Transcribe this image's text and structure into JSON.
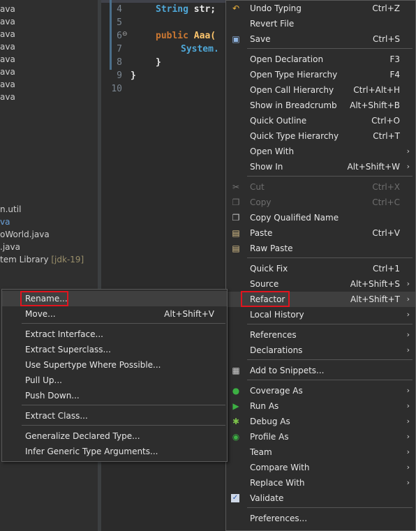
{
  "explorer": {
    "items": [
      {
        "text": "ava"
      },
      {
        "text": "ava"
      },
      {
        "text": "ava"
      },
      {
        "text": "ava"
      },
      {
        "text": "ava"
      },
      {
        "text": "ava"
      },
      {
        "text": "ava"
      },
      {
        "text": "ava"
      }
    ],
    "lower_items": [
      {
        "text": "n.util"
      },
      {
        "text": "va"
      },
      {
        "text": "oWorld.java"
      },
      {
        "text": ".java"
      },
      {
        "text": "tem Library ",
        "suffix": "[jdk-19]"
      }
    ]
  },
  "editor": {
    "line_numbers": [
      "4",
      "5",
      "6",
      "7",
      "8",
      "9",
      "10"
    ],
    "lines": [
      {
        "kw": "",
        "rest_type": "String",
        "rest": " str;"
      },
      {
        "kw": "",
        "rest_type": "",
        "rest": ""
      },
      {
        "kw": "public",
        "rest_type": "",
        "rest": " Aaa("
      },
      {
        "kw": "",
        "rest_type": "System.",
        "rest": ""
      },
      {
        "kw": "",
        "rest_type": "",
        "rest": "}"
      },
      {
        "kw": "",
        "rest_type": "",
        "rest": "}"
      }
    ]
  },
  "main_menu": {
    "items": [
      {
        "label": "Undo Typing",
        "shortcut": "Ctrl+Z",
        "icon": "undo-icon"
      },
      {
        "label": "Revert File",
        "shortcut": ""
      },
      {
        "label": "Save",
        "shortcut": "Ctrl+S",
        "icon": "save-icon"
      },
      {
        "label": "Open Declaration",
        "shortcut": "F3"
      },
      {
        "label": "Open Type Hierarchy",
        "shortcut": "F4"
      },
      {
        "label": "Open Call Hierarchy",
        "shortcut": "Ctrl+Alt+H"
      },
      {
        "label": "Show in Breadcrumb",
        "shortcut": "Alt+Shift+B"
      },
      {
        "label": "Quick Outline",
        "shortcut": "Ctrl+O"
      },
      {
        "label": "Quick Type Hierarchy",
        "shortcut": "Ctrl+T"
      },
      {
        "label": "Open With",
        "shortcut": ""
      },
      {
        "label": "Show In",
        "shortcut": "Alt+Shift+W"
      },
      {
        "label": "Cut",
        "shortcut": "Ctrl+X",
        "icon": "cut-icon"
      },
      {
        "label": "Copy",
        "shortcut": "Ctrl+C",
        "icon": "copy-icon"
      },
      {
        "label": "Copy Qualified Name",
        "shortcut": "",
        "icon": "copy-qualified-icon"
      },
      {
        "label": "Paste",
        "shortcut": "Ctrl+V",
        "icon": "paste-icon"
      },
      {
        "label": "Raw Paste",
        "shortcut": "",
        "icon": "raw-paste-icon"
      },
      {
        "label": "Quick Fix",
        "shortcut": "Ctrl+1"
      },
      {
        "label": "Source",
        "shortcut": "Alt+Shift+S"
      },
      {
        "label": "Refactor",
        "shortcut": "Alt+Shift+T"
      },
      {
        "label": "Local History",
        "shortcut": ""
      },
      {
        "label": "References",
        "shortcut": ""
      },
      {
        "label": "Declarations",
        "shortcut": ""
      },
      {
        "label": "Add to Snippets...",
        "shortcut": "",
        "icon": "snippets-icon"
      },
      {
        "label": "Coverage As",
        "shortcut": "",
        "icon": "coverage-icon"
      },
      {
        "label": "Run As",
        "shortcut": "",
        "icon": "run-icon"
      },
      {
        "label": "Debug As",
        "shortcut": "",
        "icon": "debug-icon"
      },
      {
        "label": "Profile As",
        "shortcut": "",
        "icon": "profile-icon"
      },
      {
        "label": "Team",
        "shortcut": ""
      },
      {
        "label": "Compare With",
        "shortcut": ""
      },
      {
        "label": "Replace With",
        "shortcut": ""
      },
      {
        "label": "Validate",
        "shortcut": "",
        "icon": "checkbox-checked-icon"
      },
      {
        "label": "Preferences...",
        "shortcut": ""
      }
    ]
  },
  "refactor_menu": {
    "items": [
      {
        "label": "Rename...",
        "shortcut": ""
      },
      {
        "label": "Move...",
        "shortcut": "Alt+Shift+V"
      },
      {
        "label": "Extract Interface...",
        "shortcut": ""
      },
      {
        "label": "Extract Superclass...",
        "shortcut": ""
      },
      {
        "label": "Use Supertype Where Possible...",
        "shortcut": ""
      },
      {
        "label": "Pull Up...",
        "shortcut": ""
      },
      {
        "label": "Push Down...",
        "shortcut": ""
      },
      {
        "label": "Extract Class...",
        "shortcut": ""
      },
      {
        "label": "Generalize Declared Type...",
        "shortcut": ""
      },
      {
        "label": "Infer Generic Type Arguments...",
        "shortcut": ""
      }
    ]
  },
  "colors": {
    "highlight_box": "#e0141e",
    "menu_bg": "#2d2d2d",
    "keyword": "#cc7832",
    "type": "#4fa8d8"
  }
}
